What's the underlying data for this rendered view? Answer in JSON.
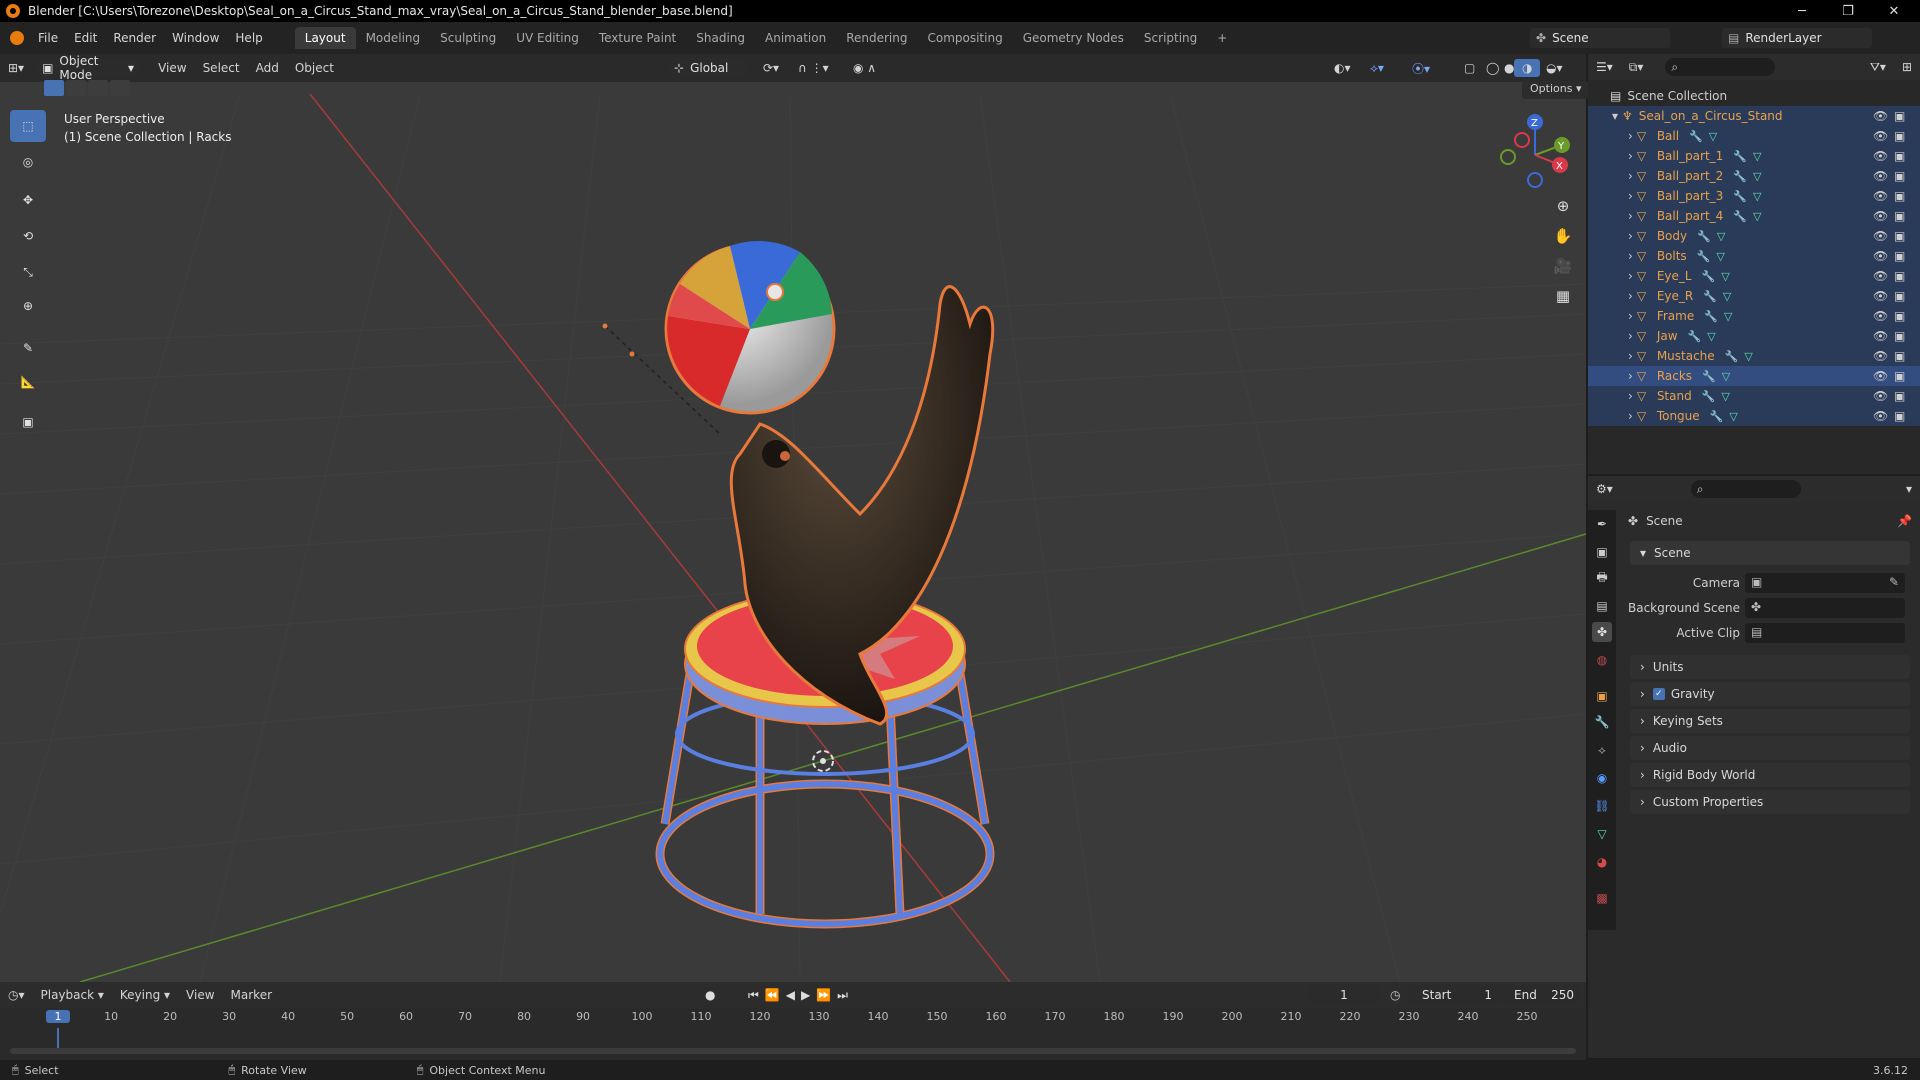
{
  "window": {
    "title": "Blender [C:\\Users\\Torezone\\Desktop\\Seal_on_a_Circus_Stand_max_vray\\Seal_on_a_Circus_Stand_blender_base.blend]",
    "minimize": "─",
    "maximize": "❐",
    "close": "✕"
  },
  "menu": [
    "File",
    "Edit",
    "Render",
    "Window",
    "Help"
  ],
  "workspaces": [
    "Layout",
    "Modeling",
    "Sculpting",
    "UV Editing",
    "Texture Paint",
    "Shading",
    "Animation",
    "Rendering",
    "Compositing",
    "Geometry Nodes",
    "Scripting"
  ],
  "workspace_add": "+",
  "scene_field": "Scene",
  "renderlayer_field": "RenderLayer",
  "viewport": {
    "mode": "Object Mode",
    "menus": [
      "View",
      "Select",
      "Add",
      "Object"
    ],
    "orientation": "Global",
    "options": "Options",
    "info_line1": "User Perspective",
    "info_line2": "(1) Scene Collection | Racks",
    "gizmo": {
      "x": "X",
      "y": "Y",
      "z": "Z"
    }
  },
  "outliner": {
    "root": "Scene Collection",
    "collection": "Seal_on_a_Circus_Stand",
    "items": [
      "Ball",
      "Ball_part_1",
      "Ball_part_2",
      "Ball_part_3",
      "Ball_part_4",
      "Body",
      "Bolts",
      "Eye_L",
      "Eye_R",
      "Frame",
      "Jaw",
      "Mustache",
      "Racks",
      "Stand",
      "Tongue"
    ],
    "selected": "Racks"
  },
  "properties": {
    "header": "Scene",
    "panel": "Scene",
    "camera_label": "Camera",
    "background_label": "Background Scene",
    "clip_label": "Active Clip",
    "sections": [
      "Units",
      "Gravity",
      "Keying Sets",
      "Audio",
      "Rigid Body World",
      "Custom Properties"
    ],
    "gravity_checked": true
  },
  "timeline": {
    "menus": [
      "Playback",
      "Keying",
      "View",
      "Marker"
    ],
    "current_frame": "1",
    "start_label": "Start",
    "start_value": "1",
    "end_label": "End",
    "end_value": "250",
    "ruler": [
      "1",
      "10",
      "20",
      "30",
      "40",
      "50",
      "60",
      "70",
      "80",
      "90",
      "100",
      "110",
      "120",
      "130",
      "140",
      "150",
      "160",
      "170",
      "180",
      "190",
      "200",
      "210",
      "220",
      "230",
      "240",
      "250"
    ]
  },
  "status": {
    "select": "Select",
    "rotate": "Rotate View",
    "context": "Object Context Menu",
    "version": "3.6.12"
  },
  "colors": {
    "accent": "#4772b3",
    "selection": "#334d80",
    "outline": "#e8793a",
    "stand_blue": "#5b7fe0",
    "stand_red": "#e8434a"
  }
}
